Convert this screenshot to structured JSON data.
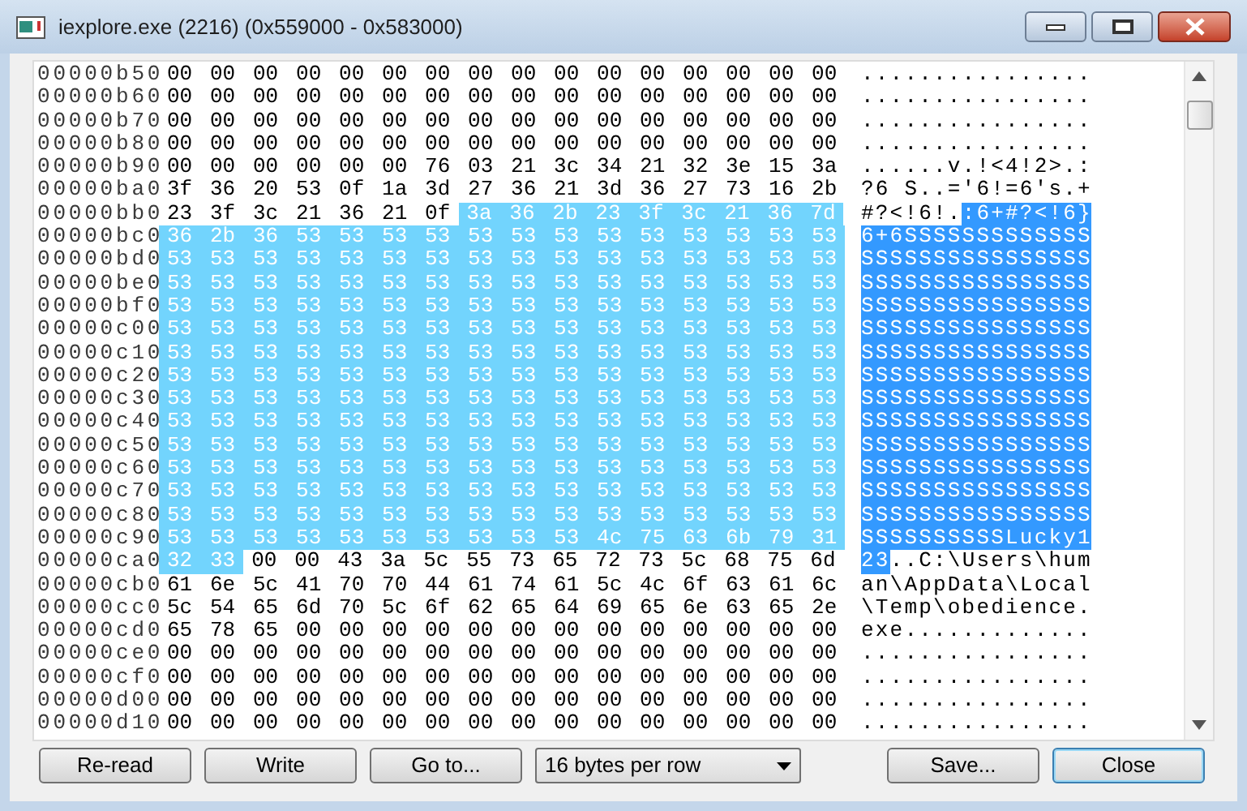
{
  "window": {
    "title": "iexplore.exe (2216) (0x559000 - 0x583000)"
  },
  "hex_view": {
    "rows": [
      {
        "offset": "00000b50",
        "hex": [
          {
            "text": "00 00 00 00 00 00 00 00 00 00 00 00 00 00 00 00",
            "selected": false
          }
        ],
        "ascii": [
          {
            "text": "................",
            "selected": false
          }
        ]
      },
      {
        "offset": "00000b60",
        "hex": [
          {
            "text": "00 00 00 00 00 00 00 00 00 00 00 00 00 00 00 00",
            "selected": false
          }
        ],
        "ascii": [
          {
            "text": "................",
            "selected": false
          }
        ]
      },
      {
        "offset": "00000b70",
        "hex": [
          {
            "text": "00 00 00 00 00 00 00 00 00 00 00 00 00 00 00 00",
            "selected": false
          }
        ],
        "ascii": [
          {
            "text": "................",
            "selected": false
          }
        ]
      },
      {
        "offset": "00000b80",
        "hex": [
          {
            "text": "00 00 00 00 00 00 00 00 00 00 00 00 00 00 00 00",
            "selected": false
          }
        ],
        "ascii": [
          {
            "text": "................",
            "selected": false
          }
        ]
      },
      {
        "offset": "00000b90",
        "hex": [
          {
            "text": "00 00 00 00 00 00 76 03 21 3c 34 21 32 3e 15 3a",
            "selected": false
          }
        ],
        "ascii": [
          {
            "text": "......v.!<4!2>.:",
            "selected": false
          }
        ]
      },
      {
        "offset": "00000ba0",
        "hex": [
          {
            "text": "3f 36 20 53 0f 1a 3d 27 36 21 3d 36 27 73 16 2b",
            "selected": false
          }
        ],
        "ascii": [
          {
            "text": "?6 S..='6!=6's.+",
            "selected": false
          }
        ]
      },
      {
        "offset": "00000bb0",
        "hex": [
          {
            "text": "23 3f 3c 21 36 21 0f",
            "selected": false
          },
          {
            "text": "3a 36 2b 23 3f 3c 21 36 7d",
            "selected": true
          }
        ],
        "ascii": [
          {
            "text": "#?<!6!.",
            "selected": false
          },
          {
            "text": ":6+#?<!6}",
            "selected": true
          }
        ]
      },
      {
        "offset": "00000bc0",
        "hex": [
          {
            "text": "36 2b 36 53 53 53 53 53 53 53 53 53 53 53 53 53",
            "selected": true
          }
        ],
        "ascii": [
          {
            "text": "6+6SSSSSSSSSSSSS",
            "selected": true
          }
        ]
      },
      {
        "offset": "00000bd0",
        "hex": [
          {
            "text": "53 53 53 53 53 53 53 53 53 53 53 53 53 53 53 53",
            "selected": true
          }
        ],
        "ascii": [
          {
            "text": "SSSSSSSSSSSSSSSS",
            "selected": true
          }
        ]
      },
      {
        "offset": "00000be0",
        "hex": [
          {
            "text": "53 53 53 53 53 53 53 53 53 53 53 53 53 53 53 53",
            "selected": true
          }
        ],
        "ascii": [
          {
            "text": "SSSSSSSSSSSSSSSS",
            "selected": true
          }
        ]
      },
      {
        "offset": "00000bf0",
        "hex": [
          {
            "text": "53 53 53 53 53 53 53 53 53 53 53 53 53 53 53 53",
            "selected": true
          }
        ],
        "ascii": [
          {
            "text": "SSSSSSSSSSSSSSSS",
            "selected": true
          }
        ]
      },
      {
        "offset": "00000c00",
        "hex": [
          {
            "text": "53 53 53 53 53 53 53 53 53 53 53 53 53 53 53 53",
            "selected": true
          }
        ],
        "ascii": [
          {
            "text": "SSSSSSSSSSSSSSSS",
            "selected": true
          }
        ]
      },
      {
        "offset": "00000c10",
        "hex": [
          {
            "text": "53 53 53 53 53 53 53 53 53 53 53 53 53 53 53 53",
            "selected": true
          }
        ],
        "ascii": [
          {
            "text": "SSSSSSSSSSSSSSSS",
            "selected": true
          }
        ]
      },
      {
        "offset": "00000c20",
        "hex": [
          {
            "text": "53 53 53 53 53 53 53 53 53 53 53 53 53 53 53 53",
            "selected": true
          }
        ],
        "ascii": [
          {
            "text": "SSSSSSSSSSSSSSSS",
            "selected": true
          }
        ]
      },
      {
        "offset": "00000c30",
        "hex": [
          {
            "text": "53 53 53 53 53 53 53 53 53 53 53 53 53 53 53 53",
            "selected": true
          }
        ],
        "ascii": [
          {
            "text": "SSSSSSSSSSSSSSSS",
            "selected": true
          }
        ]
      },
      {
        "offset": "00000c40",
        "hex": [
          {
            "text": "53 53 53 53 53 53 53 53 53 53 53 53 53 53 53 53",
            "selected": true
          }
        ],
        "ascii": [
          {
            "text": "SSSSSSSSSSSSSSSS",
            "selected": true
          }
        ]
      },
      {
        "offset": "00000c50",
        "hex": [
          {
            "text": "53 53 53 53 53 53 53 53 53 53 53 53 53 53 53 53",
            "selected": true
          }
        ],
        "ascii": [
          {
            "text": "SSSSSSSSSSSSSSSS",
            "selected": true
          }
        ]
      },
      {
        "offset": "00000c60",
        "hex": [
          {
            "text": "53 53 53 53 53 53 53 53 53 53 53 53 53 53 53 53",
            "selected": true
          }
        ],
        "ascii": [
          {
            "text": "SSSSSSSSSSSSSSSS",
            "selected": true
          }
        ]
      },
      {
        "offset": "00000c70",
        "hex": [
          {
            "text": "53 53 53 53 53 53 53 53 53 53 53 53 53 53 53 53",
            "selected": true
          }
        ],
        "ascii": [
          {
            "text": "SSSSSSSSSSSSSSSS",
            "selected": true
          }
        ]
      },
      {
        "offset": "00000c80",
        "hex": [
          {
            "text": "53 53 53 53 53 53 53 53 53 53 53 53 53 53 53 53",
            "selected": true
          }
        ],
        "ascii": [
          {
            "text": "SSSSSSSSSSSSSSSS",
            "selected": true
          }
        ]
      },
      {
        "offset": "00000c90",
        "hex": [
          {
            "text": "53 53 53 53 53 53 53 53 53 53 4c 75 63 6b 79 31",
            "selected": true
          }
        ],
        "ascii": [
          {
            "text": "SSSSSSSSSSLucky1",
            "selected": true
          }
        ]
      },
      {
        "offset": "00000ca0",
        "hex": [
          {
            "text": "32 33",
            "selected": true
          },
          {
            "text": "00 00 43 3a 5c 55 73 65 72 73 5c 68 75 6d",
            "selected": false
          }
        ],
        "ascii": [
          {
            "text": "23",
            "selected": true
          },
          {
            "text": "..C:\\Users\\hum",
            "selected": false
          }
        ]
      },
      {
        "offset": "00000cb0",
        "hex": [
          {
            "text": "61 6e 5c 41 70 70 44 61 74 61 5c 4c 6f 63 61 6c",
            "selected": false
          }
        ],
        "ascii": [
          {
            "text": "an\\AppData\\Local",
            "selected": false
          }
        ]
      },
      {
        "offset": "00000cc0",
        "hex": [
          {
            "text": "5c 54 65 6d 70 5c 6f 62 65 64 69 65 6e 63 65 2e",
            "selected": false
          }
        ],
        "ascii": [
          {
            "text": "\\Temp\\obedience.",
            "selected": false
          }
        ]
      },
      {
        "offset": "00000cd0",
        "hex": [
          {
            "text": "65 78 65 00 00 00 00 00 00 00 00 00 00 00 00 00",
            "selected": false
          }
        ],
        "ascii": [
          {
            "text": "exe.............",
            "selected": false
          }
        ]
      },
      {
        "offset": "00000ce0",
        "hex": [
          {
            "text": "00 00 00 00 00 00 00 00 00 00 00 00 00 00 00 00",
            "selected": false
          }
        ],
        "ascii": [
          {
            "text": "................",
            "selected": false
          }
        ]
      },
      {
        "offset": "00000cf0",
        "hex": [
          {
            "text": "00 00 00 00 00 00 00 00 00 00 00 00 00 00 00 00",
            "selected": false
          }
        ],
        "ascii": [
          {
            "text": "................",
            "selected": false
          }
        ]
      },
      {
        "offset": "00000d00",
        "hex": [
          {
            "text": "00 00 00 00 00 00 00 00 00 00 00 00 00 00 00 00",
            "selected": false
          }
        ],
        "ascii": [
          {
            "text": "................",
            "selected": false
          }
        ]
      },
      {
        "offset": "00000d10",
        "hex": [
          {
            "text": "00 00 00 00 00 00 00 00 00 00 00 00 00 00 00 00",
            "selected": false
          }
        ],
        "ascii": [
          {
            "text": "................",
            "selected": false
          }
        ]
      }
    ]
  },
  "left_buttons": [
    {
      "label": "Re-read",
      "default": false
    },
    {
      "label": "Write",
      "default": false
    },
    {
      "label": "Go to...",
      "default": false
    }
  ],
  "row_size_dropdown": {
    "value": "16 bytes per row"
  },
  "right_buttons": [
    {
      "label": "Save...",
      "default": false
    },
    {
      "label": "Close",
      "default": true
    }
  ]
}
